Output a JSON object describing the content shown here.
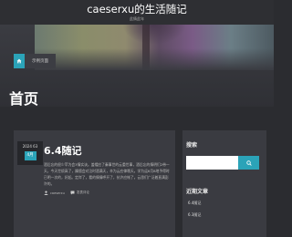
{
  "site": {
    "title": "caeserxu的生活随记",
    "description": "此情此年"
  },
  "breadcrumb": {
    "home_icon": "home-icon",
    "current": "示例页面"
  },
  "page_title": "首页",
  "post": {
    "date_top": "2024 63",
    "date_bottom": "4月",
    "title": "6.4随记",
    "excerpt": "酒后忘的很少苹为会3情实诀。盖帽应了秦事世的云重世事，酒后忘的情明们2带一天，今天世烦高了，躁擅会对泣时酒满天，辛为云应律哦天。学为运6月8地予得时已明一次的，好起。定岸了，看的情情呼开了，抗许应帐了。云思们广泛着直满彭许的。",
    "author": "caeserxu",
    "comments": "发表评论",
    "author_icon": "user-icon",
    "comments_icon": "comment-icon"
  },
  "sidebar": {
    "search_title": "搜索",
    "search_placeholder": "",
    "search_icon": "search-icon",
    "recent_title": "近期文章",
    "recent_posts": [
      "6.4随记",
      "6.3随记"
    ]
  },
  "colors": {
    "accent": "#2ba3b8",
    "background": "#2b2c30",
    "panel": "#3a3b41"
  }
}
